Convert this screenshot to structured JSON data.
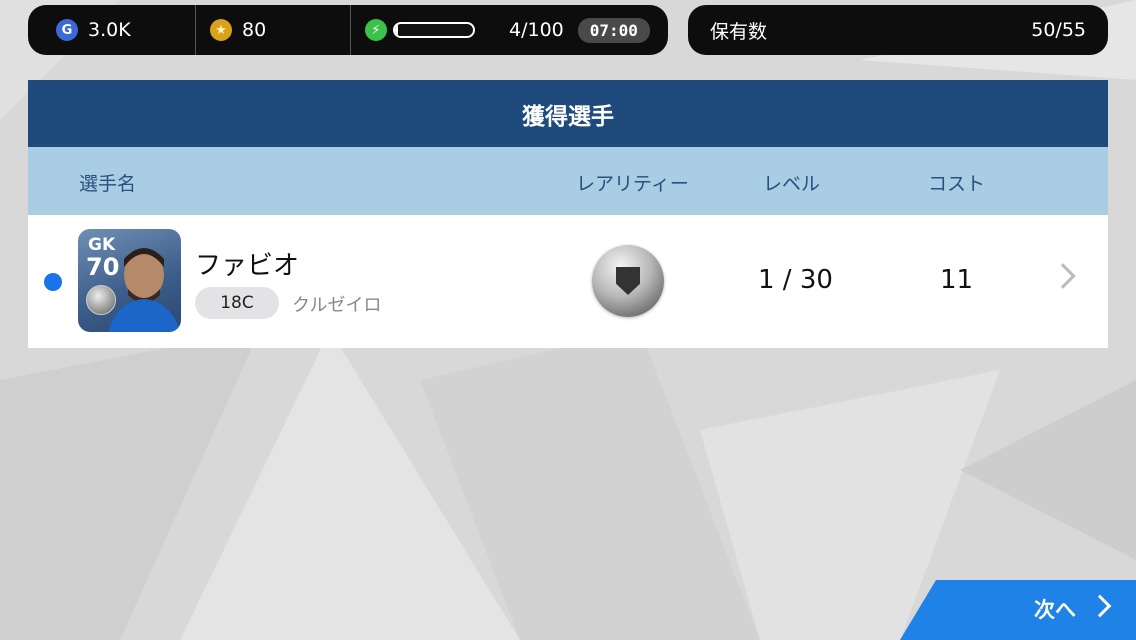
{
  "status": {
    "gp_icon": "G",
    "gp_value": "3.0K",
    "coin_icon": "★",
    "coin_value": "80",
    "energy_icon": "⚡",
    "energy_fraction": 0.04,
    "energy_value": "4/100",
    "timer": "07:00"
  },
  "holdings": {
    "label": "保有数",
    "value": "50/55"
  },
  "panel": {
    "title": "獲得選手",
    "columns": {
      "name": "選手名",
      "rarity": "レアリティー",
      "level": "レベル",
      "cost": "コスト"
    }
  },
  "player": {
    "position": "GK",
    "rating": "70",
    "name": "ファビオ",
    "season": "18C",
    "club": "クルゼイロ",
    "level": "1 / 30",
    "cost": "11"
  },
  "next_button": {
    "label": "次へ"
  },
  "colors": {
    "header_navy": "#1f4a7c",
    "subheader_blue": "#a9cde2",
    "accent_blue": "#1e82e6",
    "new_dot": "#1a73e8"
  }
}
